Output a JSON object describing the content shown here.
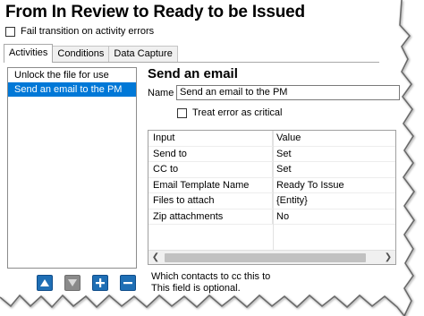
{
  "title": "From In Review to Ready to be Issued",
  "fail_transition_label": "Fail transition on activity errors",
  "tabs": [
    {
      "label": "Activities",
      "active": true
    },
    {
      "label": "Conditions",
      "active": false
    },
    {
      "label": "Data Capture",
      "active": false
    }
  ],
  "activities": [
    {
      "label": "Unlock the file for use",
      "selected": false
    },
    {
      "label": "Send an email to the PM",
      "selected": true
    }
  ],
  "list_buttons": [
    {
      "icon": "move-up-icon",
      "color": "blue"
    },
    {
      "icon": "move-down-icon",
      "color": "grey"
    },
    {
      "icon": "add-icon",
      "color": "blue"
    },
    {
      "icon": "remove-icon",
      "color": "blue"
    }
  ],
  "detail": {
    "section_title": "Send an email",
    "name_label": "Name",
    "name_value": "Send an email to the PM",
    "treat_error_label": "Treat error as critical"
  },
  "grid": {
    "headers": {
      "input": "Input",
      "value": "Value"
    },
    "rows": [
      {
        "input": "Send to",
        "value": "Set"
      },
      {
        "input": "CC to",
        "value": "Set"
      },
      {
        "input": "Email Template Name",
        "value": "Ready To Issue"
      },
      {
        "input": "Files to attach",
        "value": "{Entity}"
      },
      {
        "input": "Zip attachments",
        "value": "No"
      }
    ]
  },
  "description": {
    "line1": "Which contacts to cc this to",
    "line2": "This field is optional."
  },
  "colors": {
    "selection": "#0078d7",
    "button_blue": "#1f6fb5",
    "button_grey": "#8a8a8a"
  }
}
